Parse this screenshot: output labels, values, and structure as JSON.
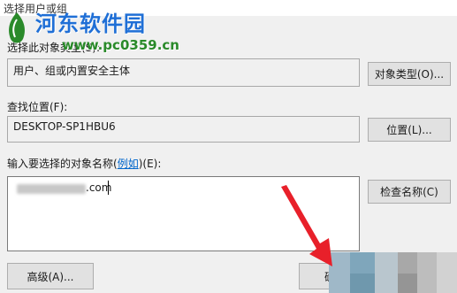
{
  "window": {
    "title": "选择用户或组"
  },
  "watermark": {
    "site_name": "河东软件园",
    "url": "www.pc0359.cn"
  },
  "object_type": {
    "label": "选择此对象类型(S):",
    "value": "用户、组或内置安全主体",
    "button": "对象类型(O)..."
  },
  "location": {
    "label": "查找位置(F):",
    "value": "DESKTOP-SP1HBU6",
    "button": "位置(L)..."
  },
  "object_names": {
    "label_prefix": "输入要选择的对象名称(",
    "label_link": "例如",
    "label_suffix": ")(E):",
    "value_suffix": ".com",
    "button": "检查名称(C)"
  },
  "footer": {
    "advanced_button": "高级(A)...",
    "ok_button": "确"
  },
  "colors": {
    "arrow": "#e8202a",
    "link": "#0066cc"
  }
}
